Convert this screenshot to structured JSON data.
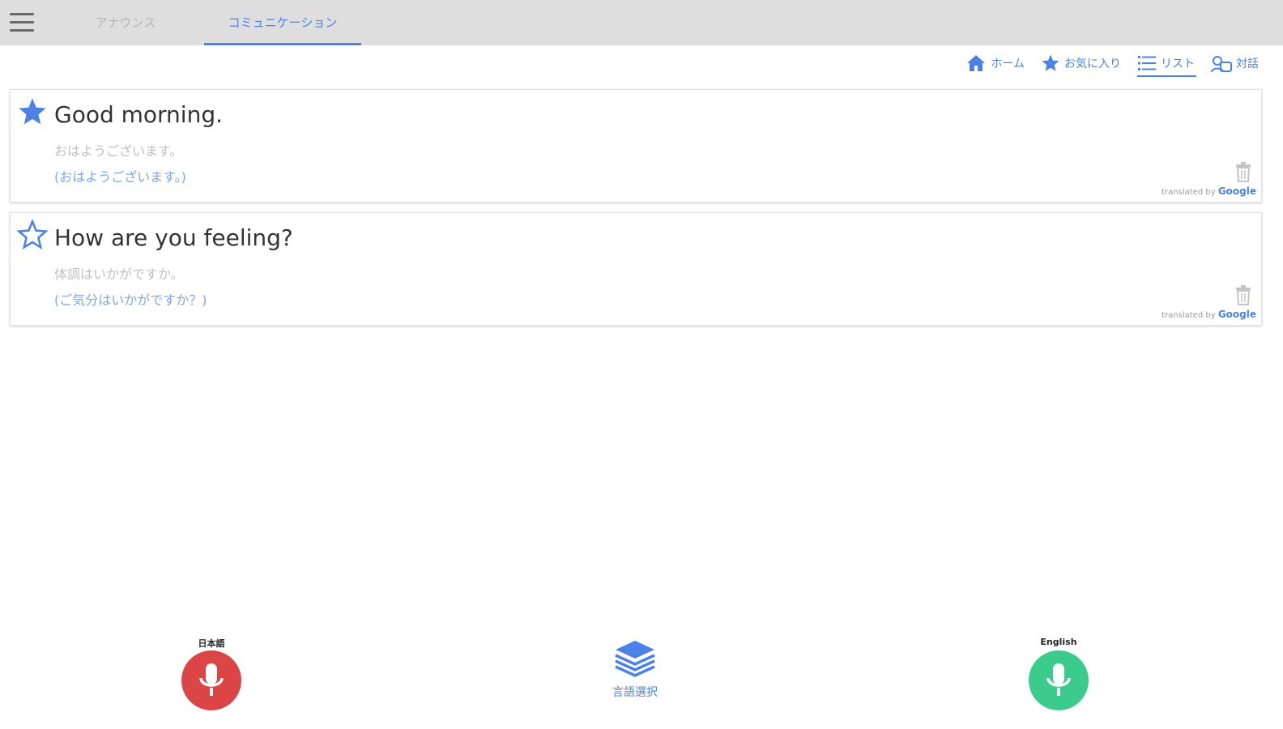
{
  "header": {
    "tabs": [
      {
        "label": "アナウンス",
        "active": false
      },
      {
        "label": "コミュニケーション",
        "active": true
      }
    ]
  },
  "toolbar": {
    "home_label": "ホーム",
    "favorites_label": "お気に入り",
    "list_label": "リスト",
    "chat_label": "対話"
  },
  "cards": [
    {
      "favorite": true,
      "text": "Good morning.",
      "translation": "おはようございます。",
      "reading": "(おはようございます。)",
      "credit_prefix": "translated by",
      "credit_brand": "Google"
    },
    {
      "favorite": false,
      "text": "How are you feeling?",
      "translation": "体調はいかがですか。",
      "reading": "(ご気分はいかがですか？)",
      "credit_prefix": "translated by",
      "credit_brand": "Google"
    }
  ],
  "bottom": {
    "left_mic_label": "日本語",
    "right_mic_label": "English",
    "language_select_label": "言語選択"
  },
  "colors": {
    "accent": "#4a82e8",
    "mic_japanese": "#dc4545",
    "mic_english": "#3bcb8c",
    "topbar": "#dedede"
  }
}
